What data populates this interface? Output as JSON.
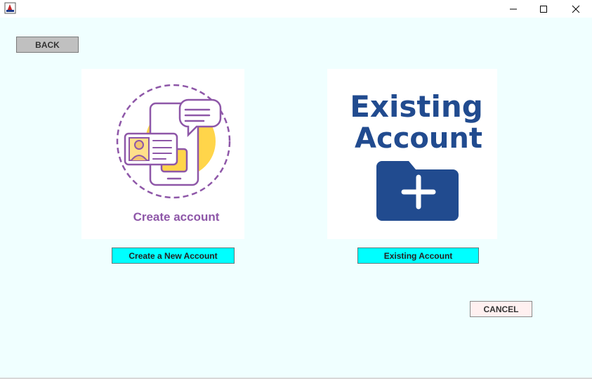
{
  "window": {
    "app_icon": "java-app-icon",
    "controls": [
      "minimize-icon",
      "maximize-icon",
      "close-icon"
    ]
  },
  "nav": {
    "back_label": "BACK"
  },
  "cards": {
    "create": {
      "image_caption": "Create account",
      "button_label": "Create a New Account",
      "accent_color": "#8e57a8",
      "highlight_color": "#ffd54a"
    },
    "existing": {
      "image_line1": "Existing",
      "image_line2": "Account",
      "button_label": "Existing Account",
      "accent_color": "#214b8f"
    }
  },
  "footer": {
    "cancel_label": "CANCEL"
  },
  "colors": {
    "background": "#f0ffff",
    "cyan_button": "#00ffff",
    "back_button": "#c0c0c0",
    "cancel_button": "#fff0f0"
  }
}
